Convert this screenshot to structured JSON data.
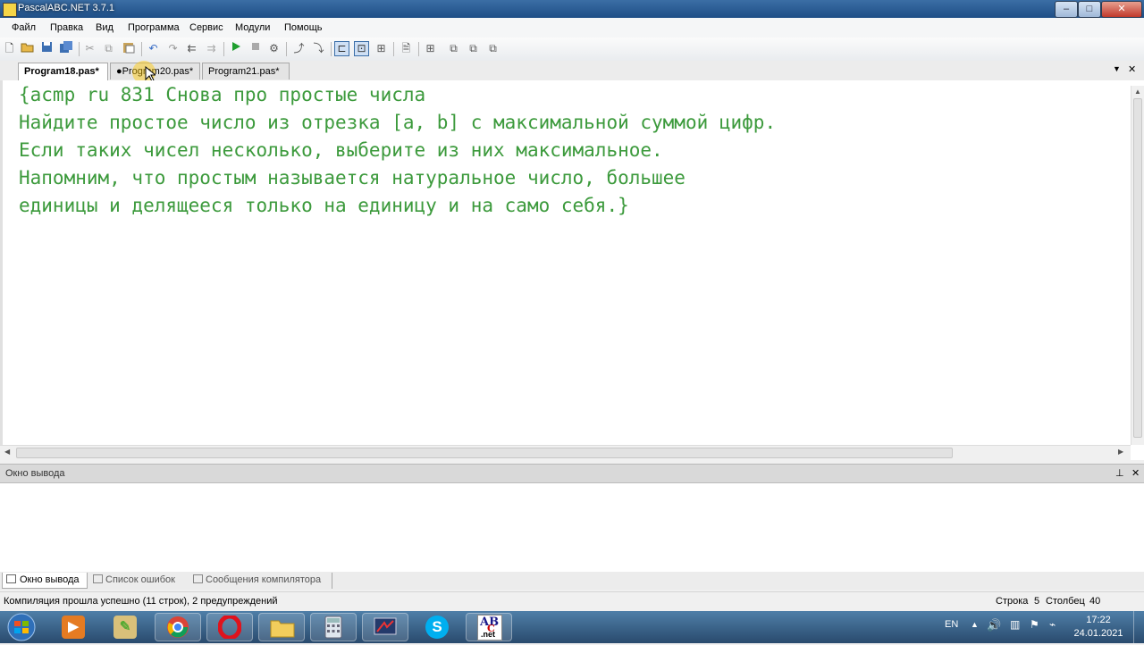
{
  "window": {
    "title": "PascalABC.NET 3.7.1",
    "btn_min": "–",
    "btn_max": "□",
    "btn_close": "✕"
  },
  "menu": [
    "Файл",
    "Правка",
    "Вид",
    "Программа",
    "Сервис",
    "Модули",
    "Помощь"
  ],
  "tabs": [
    {
      "label": "Program18.pas*",
      "active": true
    },
    {
      "label": "●Program20.pas*",
      "active": false
    },
    {
      "label": "Program21.pas*",
      "active": false
    }
  ],
  "tabbar": {
    "dropdown": "▼",
    "close": "✕"
  },
  "editor": {
    "lines": [
      "{acmp ru 831 Снова про простые числа",
      "Найдите простое число из отрезка [a, b] с максимальной суммой цифр.",
      "Если таких чисел несколько, выберите из них максимальное.",
      "Напомним, что простым называется натуральное число, большее",
      "единицы и делящееся только на единицу и на само себя.}"
    ]
  },
  "output": {
    "title": "Окно вывода",
    "pin": "⊥",
    "close": "✕"
  },
  "bottom_tabs": [
    "Окно вывода",
    "Список ошибок",
    "Сообщения компилятора"
  ],
  "status": {
    "message": "Компиляция прошла успешно (11 строк), 2 предупреждений",
    "row_label": "Строка",
    "row_value": "5",
    "col_label": "Столбец",
    "col_value": "40"
  },
  "tray": {
    "lang": "EN",
    "time": "17:22",
    "date": "24.01.2021"
  },
  "taskbar_apps": {
    "skype_letter": "S",
    "abc_label": "AB",
    "abc_sub": "C",
    "abc_net": ".net"
  }
}
